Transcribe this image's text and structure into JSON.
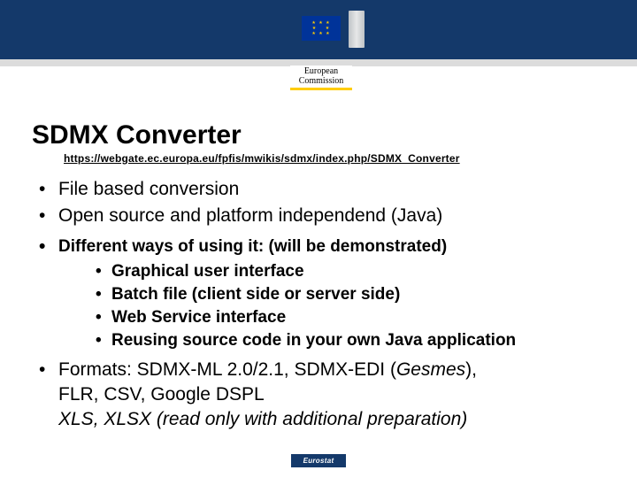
{
  "header": {
    "logo_line1": "European",
    "logo_line2": "Commission"
  },
  "title": "SDMX Converter",
  "link": "https://webgate.ec.europa.eu/fpfis/mwikis/sdmx/index.php/SDMX_Converter",
  "bullets": {
    "b1": "File based conversion",
    "b2": "Open source and platform independend (Java)",
    "b3_lead": "Different ways of using it: (will be demonstrated)",
    "b3_sub": {
      "s1": "Graphical user interface",
      "s2": "Batch file (client side or server side)",
      "s3": "Web Service interface",
      "s4": "Reusing source code in your own Java application"
    },
    "b4_part1": "Formats: SDMX-ML 2.0/2.1, SDMX-EDI (",
    "b4_gesmes": "Gesmes",
    "b4_part2": "),",
    "b4_line2": "FLR, CSV, Google DSPL",
    "b4_line3": "XLS, XLSX (read only with additional preparation)"
  },
  "footer": "Eurostat"
}
